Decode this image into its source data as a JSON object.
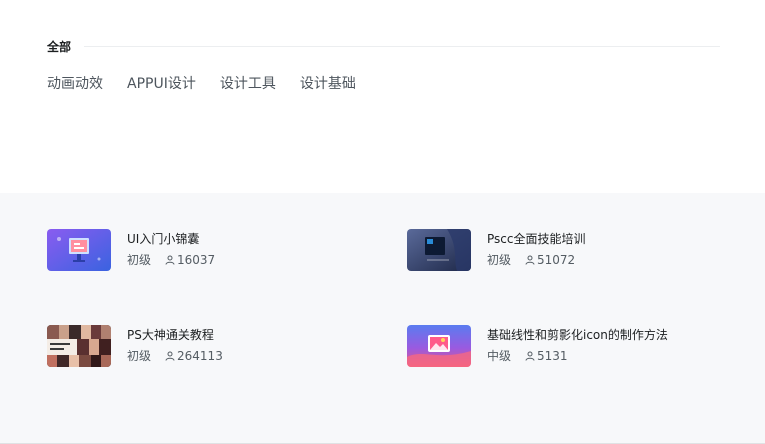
{
  "section": {
    "title": "全部"
  },
  "tags": [
    {
      "label": "动画动效"
    },
    {
      "label": "APPUI设计"
    },
    {
      "label": "设计工具"
    },
    {
      "label": "设计基础"
    }
  ],
  "courses": [
    {
      "title": "UI入门小锦囊",
      "level": "初级",
      "learners": "16037",
      "thumbnail": "ui-intro-thumbnail"
    },
    {
      "title": "Pscc全面技能培训",
      "level": "初级",
      "learners": "51072",
      "thumbnail": "pscc-thumbnail"
    },
    {
      "title": "PS大神通关教程",
      "level": "初级",
      "learners": "264113",
      "thumbnail": "ps-master-thumbnail"
    },
    {
      "title": "基础线性和剪影化icon的制作方法",
      "level": "中级",
      "learners": "5131",
      "thumbnail": "icon-making-thumbnail"
    }
  ],
  "colors": {
    "bottom_background": "#f7f8fa",
    "tag_text": "#4d555d",
    "meta_text": "#545c63"
  }
}
